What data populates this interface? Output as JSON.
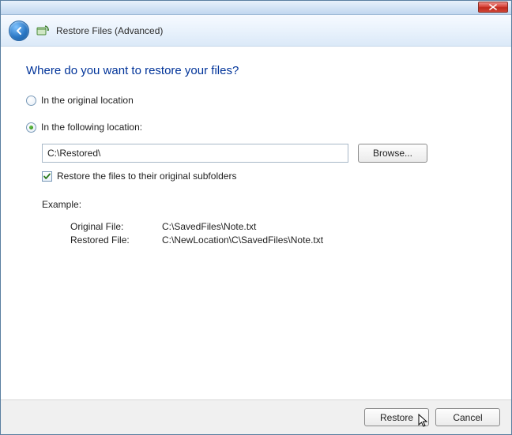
{
  "header": {
    "title": "Restore Files (Advanced)"
  },
  "heading": "Where do you want to restore your files?",
  "options": {
    "original_label": "In the original location",
    "following_label": "In the following location:",
    "selected": "following"
  },
  "path": {
    "value": "C:\\Restored\\",
    "browse_label": "Browse..."
  },
  "subfolders": {
    "checked": true,
    "label": "Restore the files to their original subfolders"
  },
  "example": {
    "heading": "Example:",
    "original_label": "Original File:",
    "original_value": "C:\\SavedFiles\\Note.txt",
    "restored_label": "Restored File:",
    "restored_value": "C:\\NewLocation\\C\\SavedFiles\\Note.txt"
  },
  "footer": {
    "restore_label": "Restore",
    "cancel_label": "Cancel"
  }
}
